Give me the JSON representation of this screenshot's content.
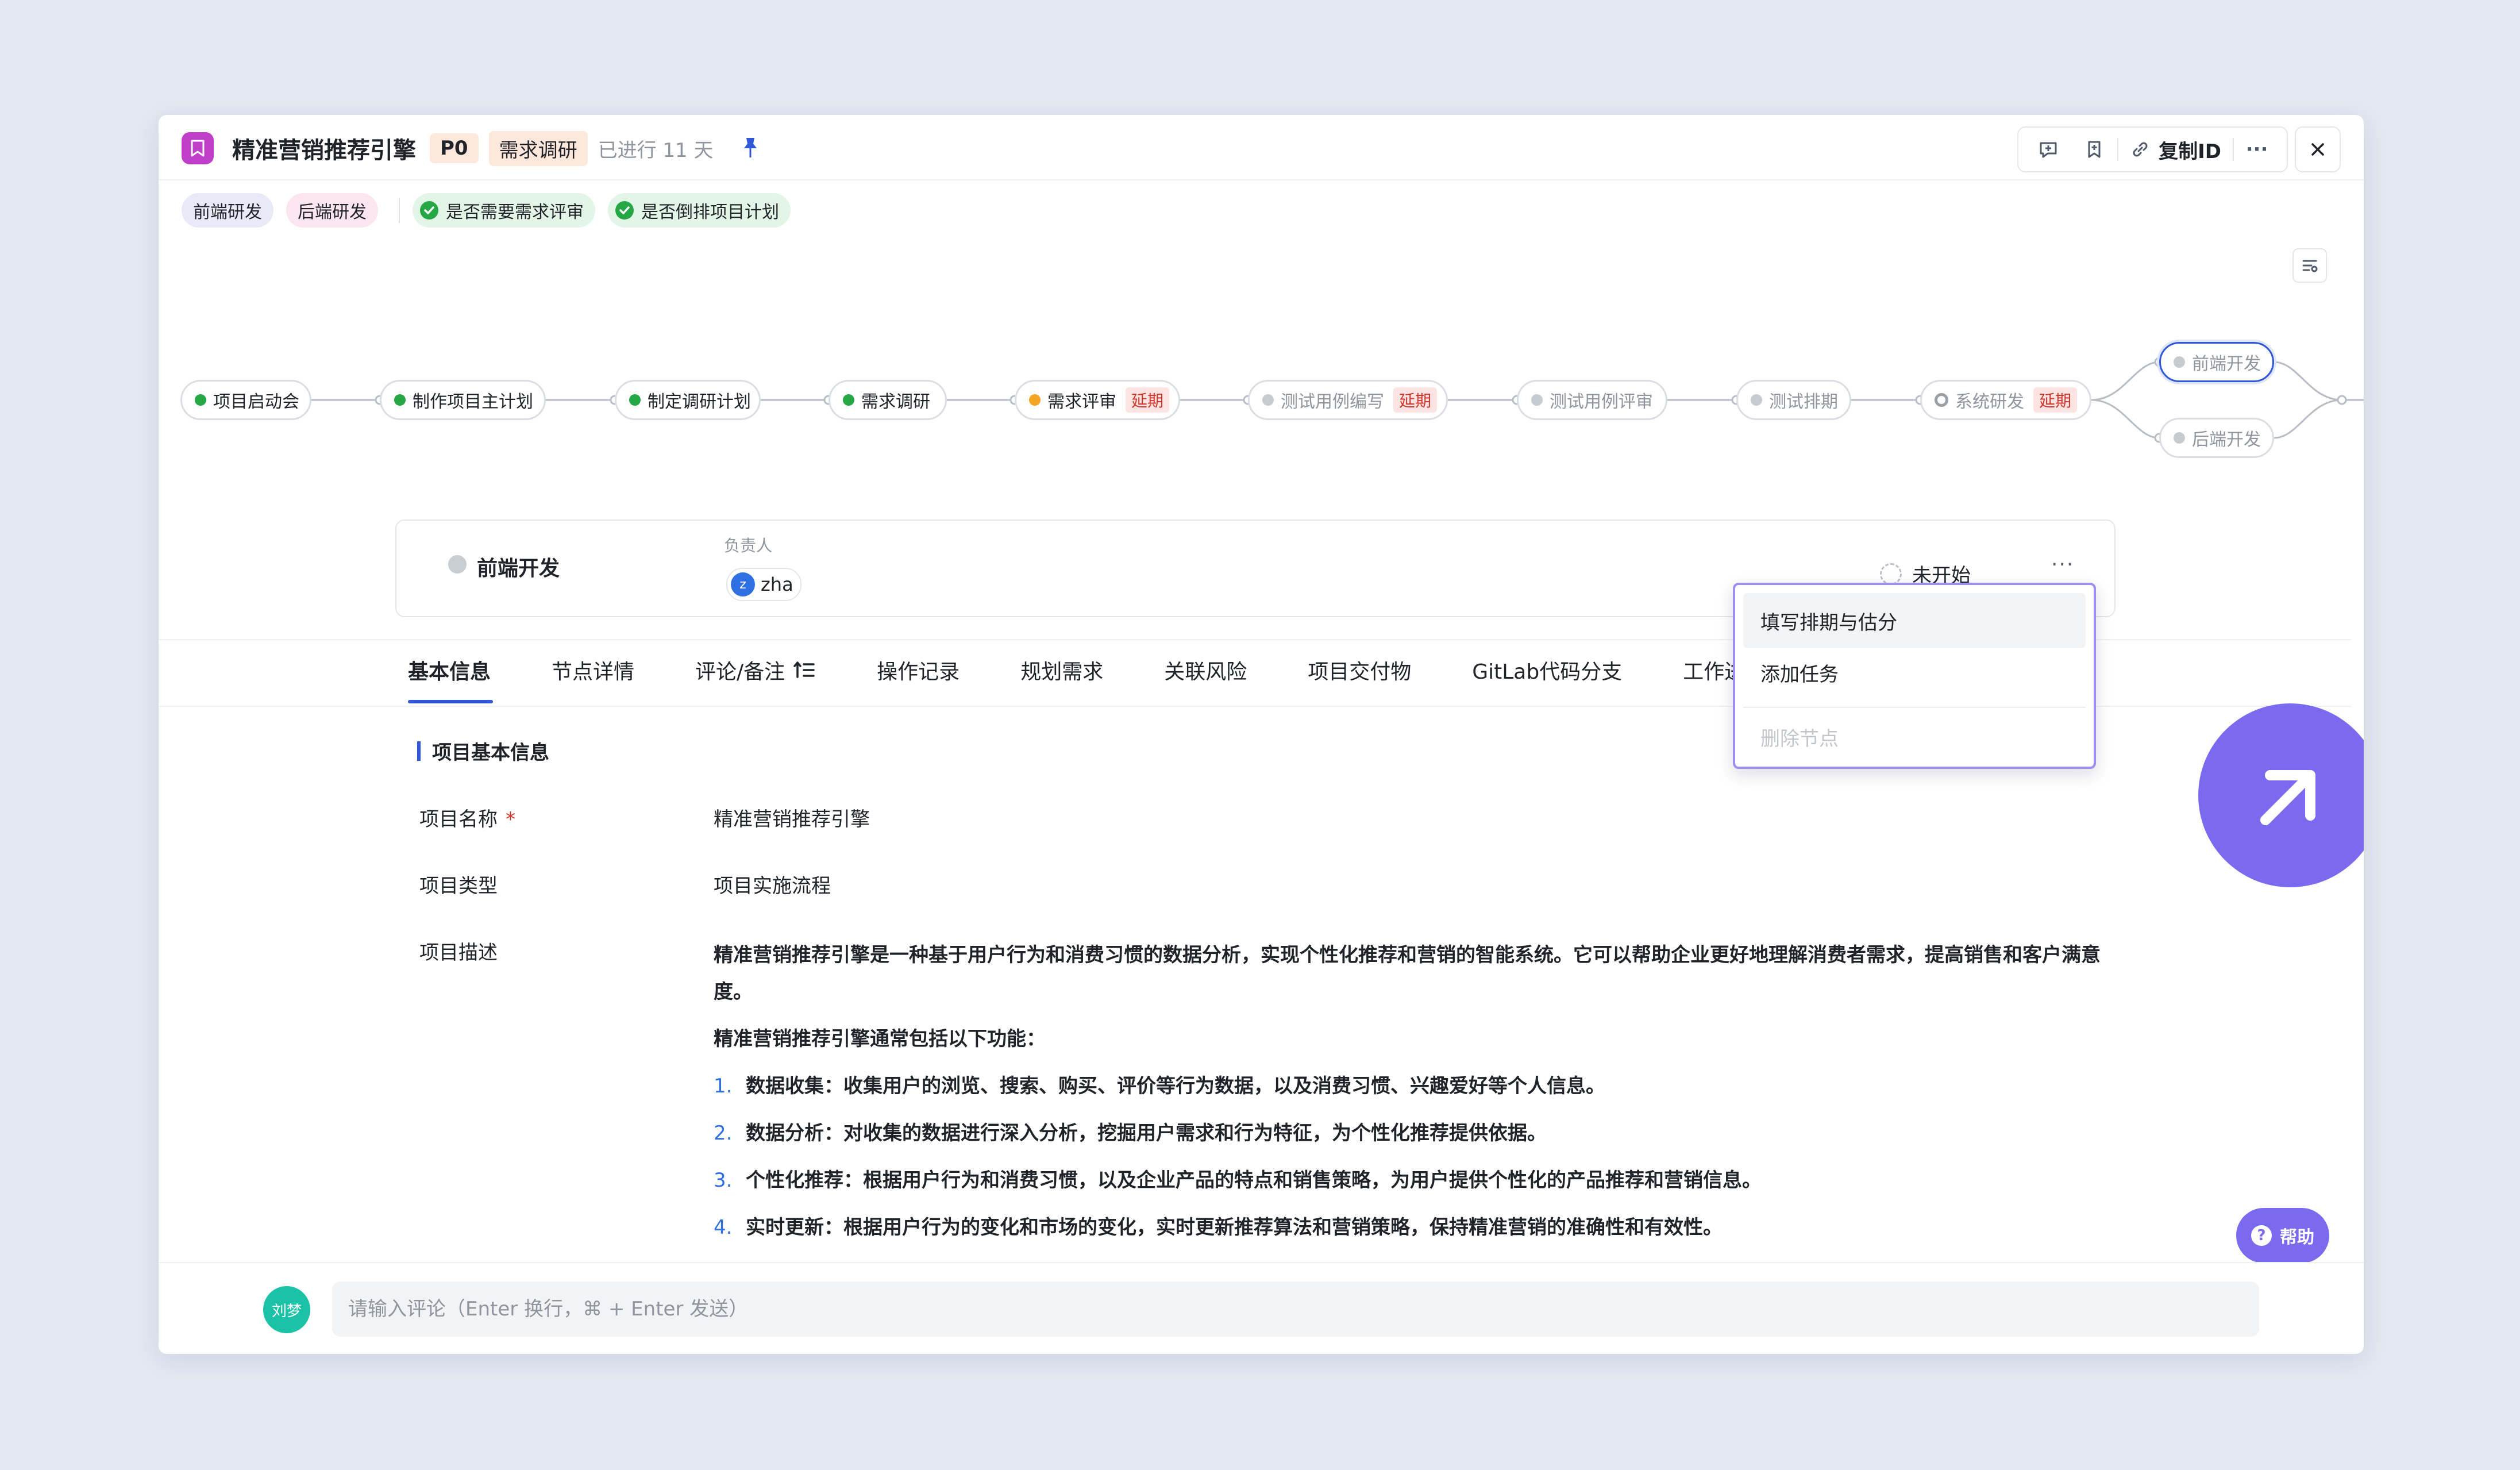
{
  "header": {
    "title": "精准营销推荐引擎",
    "priority": "P0",
    "stage": "需求调研",
    "elapsed": "已进行 11 天",
    "copy_id_label": "复制ID",
    "more_label": "···",
    "app_color": "#c03fc8"
  },
  "chips": {
    "frontend": "前端研发",
    "backend": "后端研发",
    "check_review": "是否需要需求评审",
    "check_schedule": "是否倒排项目计划"
  },
  "flow": {
    "nodes": [
      {
        "label": "项目启动会",
        "status": "done"
      },
      {
        "label": "制作项目主计划",
        "status": "done"
      },
      {
        "label": "制定调研计划",
        "status": "done"
      },
      {
        "label": "需求调研",
        "status": "done"
      },
      {
        "label": "需求评审",
        "status": "in-progress",
        "badge": "延期"
      },
      {
        "label": "测试用例编写",
        "status": "pending",
        "badge": "延期"
      },
      {
        "label": "测试用例评审",
        "status": "pending"
      },
      {
        "label": "测试排期",
        "status": "pending"
      },
      {
        "label": "系统研发",
        "status": "partial",
        "badge": "延期"
      },
      {
        "label": "前端开发",
        "status": "pending",
        "selected": true
      },
      {
        "label": "后端开发",
        "status": "pending"
      }
    ]
  },
  "detail": {
    "name": "前端开发",
    "owner_label": "负责人",
    "owner_initial": "z",
    "owner_name": "zha",
    "status": "未开始",
    "more": "···"
  },
  "menu": {
    "items": [
      "填写排期与估分",
      "添加任务",
      "删除节点"
    ]
  },
  "tabs": [
    "基本信息",
    "节点详情",
    "评论/备注",
    "操作记录",
    "规划需求",
    "关联风险",
    "项目交付物",
    "GitLab代码分支",
    "工作进展"
  ],
  "info": {
    "section_title": "项目基本信息",
    "name_label": "项目名称",
    "required_mark": "*",
    "name_value": "精准营销推荐引擎",
    "type_label": "项目类型",
    "type_value": "项目实施流程",
    "desc_label": "项目描述",
    "desc_p1": "精准营销推荐引擎是一种基于用户行为和消费习惯的数据分析，实现个性化推荐和营销的智能系统。它可以帮助企业更好地理解消费者需求，提高销售和客户满意度。",
    "desc_p2": "精准营销推荐引擎通常包括以下功能：",
    "desc_list": [
      {
        "num": "1.",
        "text": "数据收集：收集用户的浏览、搜索、购买、评价等行为数据，以及消费习惯、兴趣爱好等个人信息。"
      },
      {
        "num": "2.",
        "text": "数据分析：对收集的数据进行深入分析，挖掘用户需求和行为特征，为个性化推荐提供依据。"
      },
      {
        "num": "3.",
        "text": "个性化推荐：根据用户行为和消费习惯，以及企业产品的特点和销售策略，为用户提供个性化的产品推荐和营销信息。"
      },
      {
        "num": "4.",
        "text": "实时更新：根据用户行为的变化和市场的变化，实时更新推荐算法和营销策略，保持精准营销的准确性和有效性。"
      }
    ]
  },
  "comment": {
    "avatar": "刘梦",
    "placeholder": "请输入评论（Enter 换行，⌘ + Enter 发送）"
  },
  "help_label": "帮助",
  "colors": {
    "accent": "#2f57d6",
    "done": "#25a745",
    "in_progress": "#f5a524",
    "delay": "#d1342b",
    "cursor": "#7b6af0"
  }
}
